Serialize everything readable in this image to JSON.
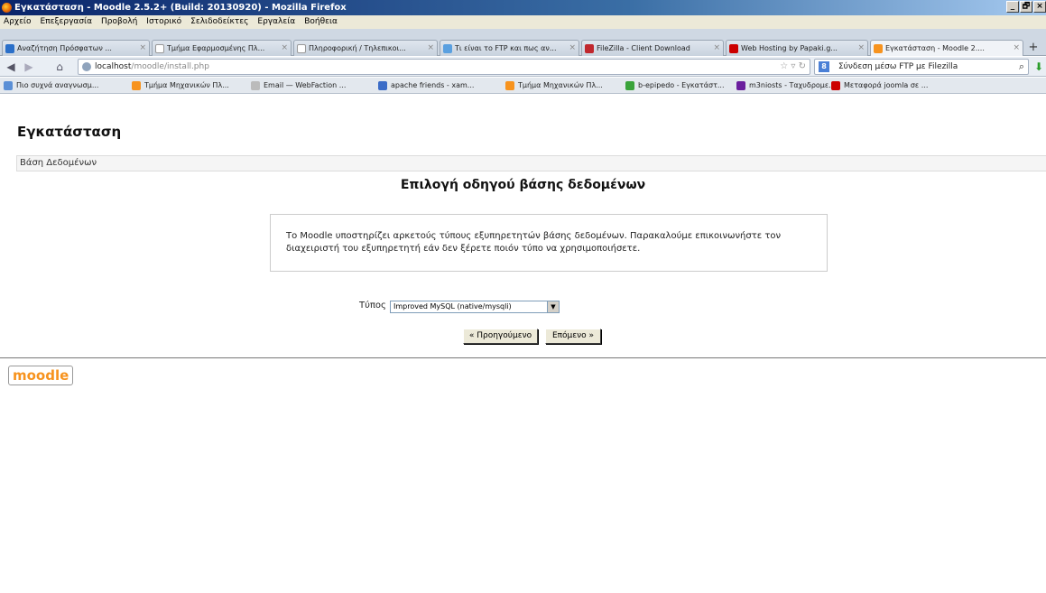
{
  "window": {
    "title": "Εγκατάσταση - Moodle 2.5.2+ (Build: 20130920) - Mozilla Firefox",
    "controls": [
      "_",
      "🗗",
      "×"
    ]
  },
  "menu": [
    "Αρχείο",
    "Επεξεργασία",
    "Προβολή",
    "Ιστορικό",
    "Σελιδοδείκτες",
    "Εργαλεία",
    "Βοήθεια"
  ],
  "tabs": [
    {
      "label": "Αναζήτηση Πρόσφατων ...",
      "icon_color": "#2a6fc9"
    },
    {
      "label": "Τμήμα Εφαρμοσμένης Πλ...",
      "icon_color": "#ffffff"
    },
    {
      "label": "Πληροφορική / Τηλεπικοι...",
      "icon_color": "#ffffff"
    },
    {
      "label": "Τι είναι το FTP και πως αν...",
      "icon_color": "#5aa0e0"
    },
    {
      "label": "FileZilla - Client Download",
      "icon_color": "#c0272d"
    },
    {
      "label": "Web Hosting by Papaki.g...",
      "icon_color": "#cc0000"
    },
    {
      "label": "Εγκατάσταση - Moodle 2....",
      "icon_color": "#f7931e"
    }
  ],
  "nav": {
    "url_host": "localhost",
    "url_path": "/moodle/install.php",
    "search_text": "Σύνδεση μέσω FTP με Filezilla",
    "search_engine_label": "8"
  },
  "bookmarks": [
    {
      "label": "Πιο συχνά αναγνωσμ...",
      "icon_color": "#5a8fd6"
    },
    {
      "label": "Τμήμα Μηχανικών Πλ...",
      "icon_color": "#f7931e"
    },
    {
      "label": "Email — WebFaction ...",
      "icon_color": "#bbbbbb"
    },
    {
      "label": "apache friends - xam...",
      "icon_color": "#3b6cc7"
    },
    {
      "label": "Τμήμα Μηχανικών Πλ...",
      "icon_color": "#f7931e"
    },
    {
      "label": "b-epipedo - Εγκατάστ...",
      "icon_color": "#3aa33a"
    },
    {
      "label": "m3niosts - Ταχυδρομε...",
      "icon_color": "#6b1f9e"
    },
    {
      "label": "Μεταφορά joomla σε ...",
      "icon_color": "#cc0000"
    }
  ],
  "page": {
    "title": "Εγκατάσταση",
    "breadcrumb": "Βάση Δεδομένων",
    "heading": "Επιλογή οδηγού βάσης δεδομένων",
    "info": "Το Moodle υποστηρίζει αρκετούς τύπους εξυπηρετητών βάσης δεδομένων. Παρακαλούμε επικοινωνήστε τον διαχειριστή του εξυπηρετητή εάν δεν ξέρετε ποιόν τύπο να χρησιμοποιήσετε.",
    "type_label": "Τύπος",
    "type_selected": "Improved MySQL (native/mysqli)",
    "prev_button": "« Προηγούμενο",
    "next_button": "Επόμενο »",
    "logo_text": "moodle"
  }
}
